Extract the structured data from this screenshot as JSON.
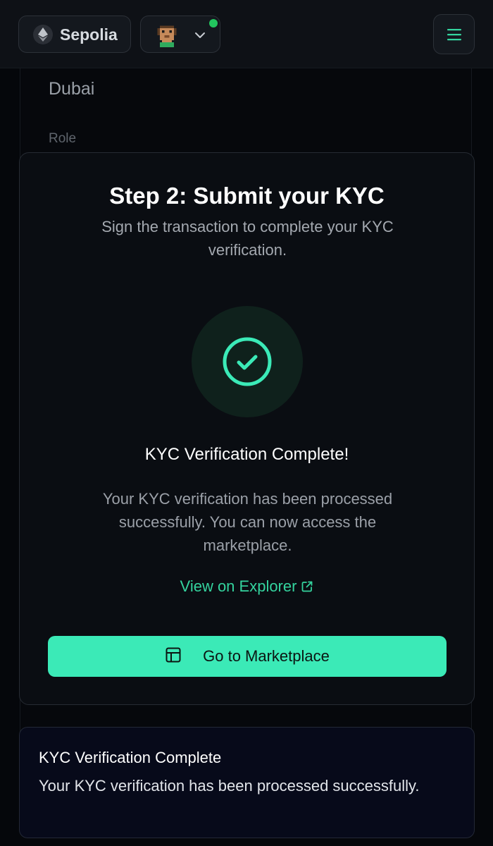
{
  "header": {
    "network_label": "Sepolia",
    "network_icon": "ethereum-icon",
    "account_icon": "pixel-avatar",
    "menu_icon": "hamburger-icon",
    "status_color": "#22c55e"
  },
  "background_form": {
    "city_value": "Dubai",
    "role_label": "Role"
  },
  "modal": {
    "title": "Step 2: Submit your KYC",
    "subtitle": "Sign the transaction to complete your KYC verification.",
    "status_icon": "check-circle-icon",
    "complete_title": "KYC Verification Complete!",
    "complete_description": "Your KYC verification has been processed successfully. You can now access the marketplace.",
    "explorer_link": "View on Explorer",
    "marketplace_button": "Go to Marketplace",
    "accent_color": "#3beab7"
  },
  "toast": {
    "title": "KYC Verification Complete",
    "body": "Your KYC verification has been processed successfully."
  }
}
